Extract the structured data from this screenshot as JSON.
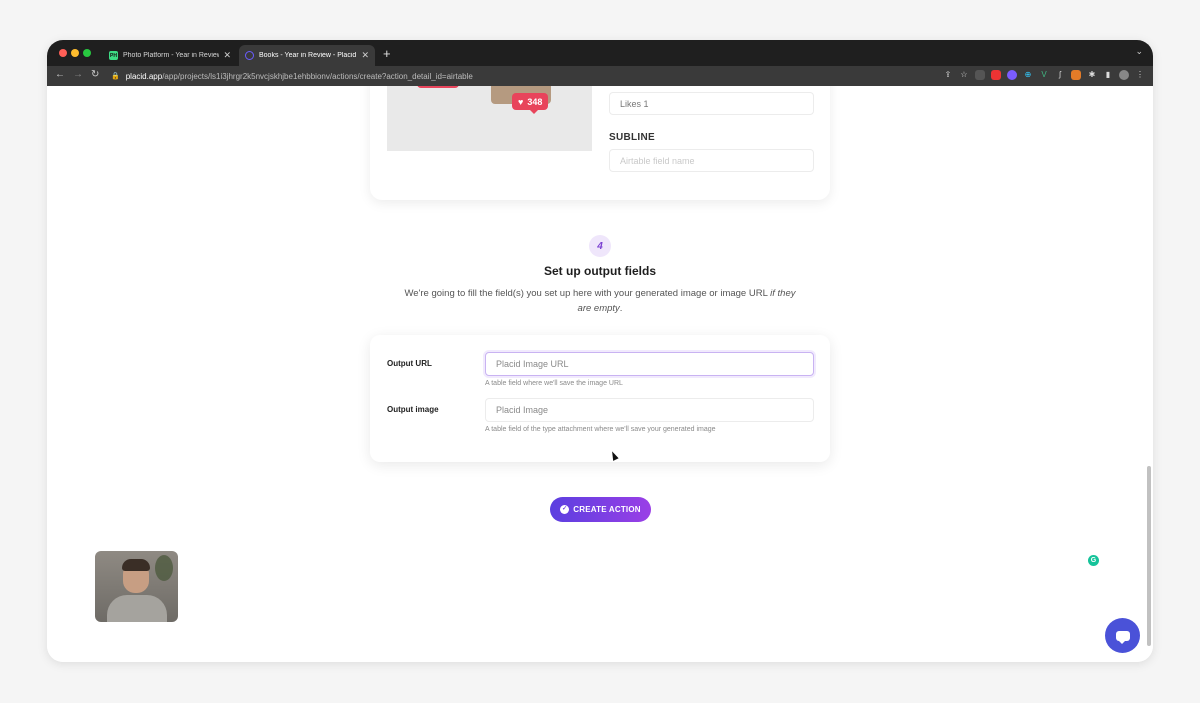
{
  "browser": {
    "tabs": [
      {
        "label": "Photo Platform - Year in Review",
        "favicon": "PH"
      },
      {
        "label": "Books - Year in Review - Placid"
      }
    ],
    "url_host": "placid.app",
    "url_path": "/app/projects/ls1i3jhrgr2k5nvcjskhjbe1ehbbionv/actions/create?action_detail_id=airtable"
  },
  "preview": {
    "likes_count": "348"
  },
  "fields_top": {
    "likes_value": "Likes 1",
    "subline_label": "SUBLINE",
    "subline_placeholder": "Airtable field name"
  },
  "step": {
    "number": "4",
    "title": "Set up output fields",
    "desc_main": "We're going to fill the field(s) you set up here with your generated image or image URL ",
    "desc_em": "if they are empty",
    "desc_end": "."
  },
  "output": {
    "url_label": "Output URL",
    "url_placeholder": "Placid Image URL",
    "url_help": "A table field where we'll save the image URL",
    "image_label": "Output image",
    "image_placeholder": "Placid Image",
    "image_help": "A table field of the type attachment where we'll save your generated image"
  },
  "create_label": "CREATE ACTION",
  "colors": {
    "accent": "#6a3fe3",
    "badge": "#e8445b",
    "chat": "#4a52d8"
  }
}
